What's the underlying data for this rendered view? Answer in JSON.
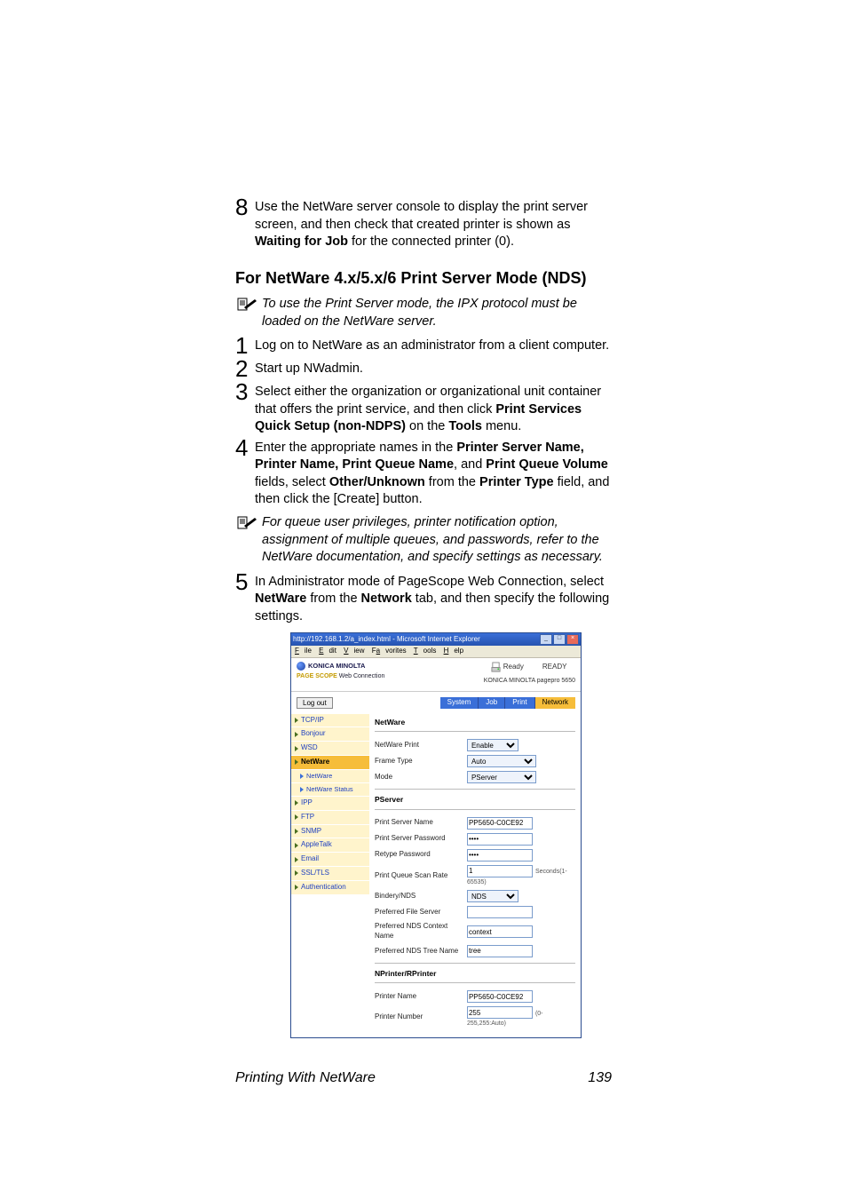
{
  "step8": {
    "num": "8",
    "text_a": "Use the NetWare server console to display the print server screen, and then check that created printer is shown as ",
    "bold_a": "Waiting for Job",
    "text_b": " for the connected printer (0)."
  },
  "section_title": "For NetWare 4.x/5.x/6 Print Server Mode (NDS)",
  "note_top": "To use the Print Server mode, the IPX protocol must be loaded on the NetWare server.",
  "steps": {
    "s1": {
      "num": "1",
      "text": "Log on to NetWare as an administrator from a client computer."
    },
    "s2": {
      "num": "2",
      "text": "Start up NWadmin."
    },
    "s3": {
      "num": "3",
      "text_a": "Select either the organization or organizational unit container that offers the print service, and then click ",
      "bold_a": "Print Services Quick Setup (non-NDPS)",
      "text_b": " on the ",
      "bold_b": "Tools",
      "text_c": " menu."
    },
    "s4": {
      "num": "4",
      "text_a": "Enter the appropriate names in the ",
      "bold_a": "Printer Server Name, Printer Name, Print Queue Name",
      "text_b": ", and ",
      "bold_b": "Print Queue Volume",
      "text_c": " fields, select ",
      "bold_c": "Other/Unknown",
      "text_d": " from the ",
      "bold_d": "Printer Type",
      "text_e": " field, and then click the [Create] button."
    }
  },
  "note_mid": "For queue user privileges, printer notification option, assignment of multiple queues, and passwords, refer to the NetWare documentation, and specify settings as necessary.",
  "s5": {
    "num": "5",
    "text_a": "In Administrator mode of PageScope Web Connection, select ",
    "bold_a": "NetWare",
    "text_b": " from the ",
    "bold_b": "Network",
    "text_c": " tab, and then specify the following settings."
  },
  "footer": {
    "left": "Printing With NetWare",
    "right": "139"
  },
  "shot": {
    "titlebar": "http://192.168.1.2/a_index.html - Microsoft Internet Explorer",
    "menubar": [
      "File",
      "Edit",
      "View",
      "Favorites",
      "Tools",
      "Help"
    ],
    "brand_top": "KONICA MINOLTA",
    "brand_sub_prefix": "PAGE SCOPE",
    "brand_sub": " Web Connection",
    "status_icon_label": "Ready",
    "status_text": "READY",
    "model": "KONICA MINOLTA pagepro 5650",
    "logout": "Log out",
    "tabs": [
      "System",
      "Job",
      "Print",
      "Network"
    ],
    "sidebar": [
      {
        "label": "TCP/IP",
        "sub": false
      },
      {
        "label": "Bonjour",
        "sub": false
      },
      {
        "label": "WSD",
        "sub": false
      },
      {
        "label": "NetWare",
        "sub": false,
        "sel": true
      },
      {
        "label": "NetWare",
        "sub": true
      },
      {
        "label": "NetWare Status",
        "sub": true
      },
      {
        "label": "IPP",
        "sub": false
      },
      {
        "label": "FTP",
        "sub": false
      },
      {
        "label": "SNMP",
        "sub": false
      },
      {
        "label": "AppleTalk",
        "sub": false
      },
      {
        "label": "Email",
        "sub": false
      },
      {
        "label": "SSL/TLS",
        "sub": false
      },
      {
        "label": "Authentication",
        "sub": false
      }
    ],
    "sec1_title": "NetWare",
    "sec1_rows": {
      "netware_print": {
        "label": "NetWare Print",
        "value": "Enable"
      },
      "frame_type": {
        "label": "Frame Type",
        "value": "Auto"
      },
      "mode": {
        "label": "Mode",
        "value": "PServer"
      }
    },
    "sec2_title": "PServer",
    "sec2_rows": {
      "print_server_name": {
        "label": "Print Server Name",
        "value": "PP5650-C0CE92"
      },
      "print_server_password": {
        "label": "Print Server Password",
        "value": "••••"
      },
      "retype_password": {
        "label": "Retype Password",
        "value": "••••"
      },
      "print_queue_scan_rate": {
        "label": "Print Queue Scan Rate",
        "value": "1",
        "hint": "Seconds(1-65535)"
      },
      "bindery_nds": {
        "label": "Bindery/NDS",
        "value": "NDS"
      },
      "preferred_file_server": {
        "label": "Preferred File Server",
        "value": ""
      },
      "preferred_nds_context_name": {
        "label": "Preferred NDS Context Name",
        "value": "context"
      },
      "preferred_nds_tree_name": {
        "label": "Preferred NDS Tree Name",
        "value": "tree"
      }
    },
    "sec3_title": "NPrinter/RPrinter",
    "sec3_rows": {
      "printer_name": {
        "label": "Printer Name",
        "value": "PP5650-C0CE92"
      },
      "printer_number": {
        "label": "Printer Number",
        "value": "255",
        "hint": "(0-255,255:Auto)"
      }
    }
  }
}
